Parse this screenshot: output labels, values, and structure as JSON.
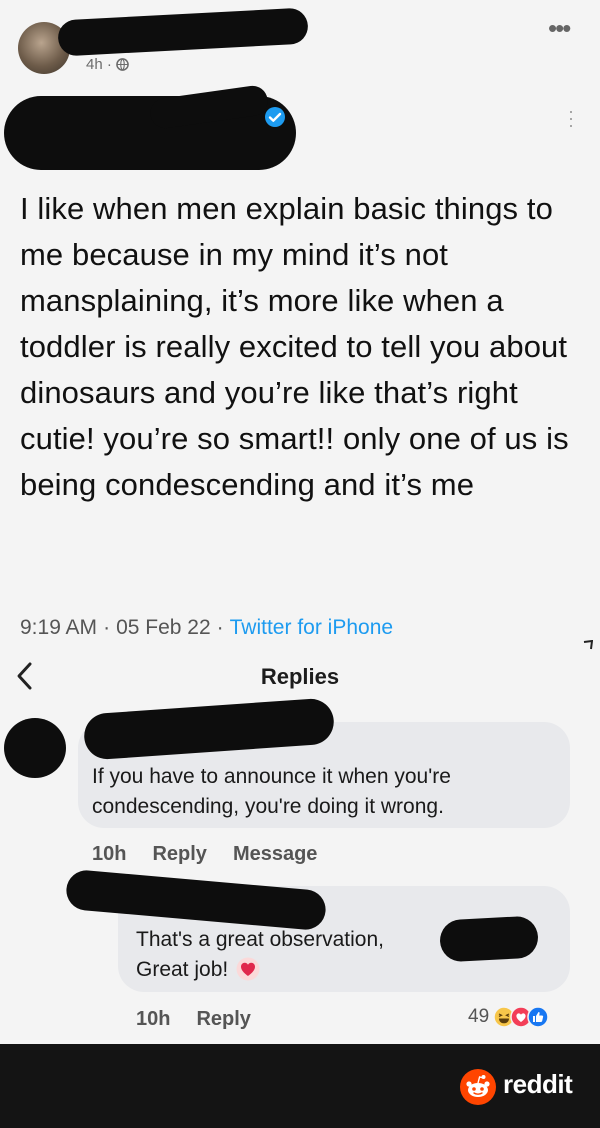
{
  "fb_post": {
    "time": "4h ·",
    "privacy_icon": "globe-icon",
    "more_icon": "more-horizontal-icon"
  },
  "tweet": {
    "verified_icon": "verified-badge-icon",
    "more_icon": "more-vertical-icon",
    "text": "I like when men explain basic things to me because in my mind it’s not mansplaining, it’s more like when a toddler is really excited to tell you about dinosaurs and you’re like that’s right cutie! you’re so smart!! only one of us is being condescending and it’s me",
    "time": "9:19 AM",
    "date": "05 Feb 22",
    "source": "Twitter for iPhone"
  },
  "replies_bar": {
    "title": "Replies",
    "back_icon": "chevron-left-icon"
  },
  "comments": [
    {
      "text": "If you have to announce it when you're condescending, you're doing it wrong.",
      "age": "10h",
      "reply_label": "Reply",
      "message_label": "Message"
    },
    {
      "text": "That's a great observation,",
      "text2": "Great job!",
      "heart_icon": "red-heart-icon",
      "age": "10h",
      "reply_label": "Reply",
      "reaction_count": "49",
      "reaction_icons": [
        "haha-icon",
        "heart-icon",
        "like-icon"
      ]
    }
  ],
  "footer": {
    "brand": "reddit",
    "logo_icon": "reddit-logo-icon"
  },
  "colors": {
    "link_blue": "#1d9bf0",
    "reddit_orange": "#ff4500",
    "footer_bg": "#141414"
  }
}
